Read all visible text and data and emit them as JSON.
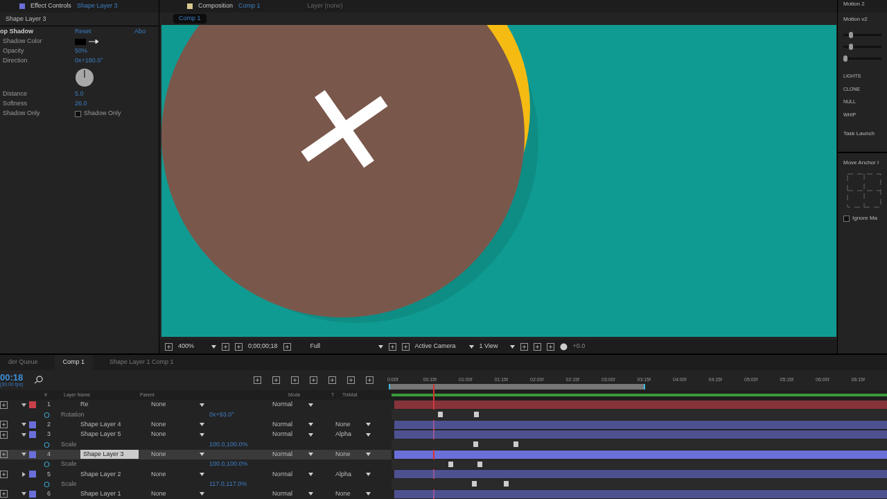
{
  "effect_panel": {
    "tab_label": "Effect Controls",
    "tab_layer": "Shape Layer 3",
    "layer_path": "Shape Layer 3",
    "effect_name": "op Shadow",
    "reset": "Reset",
    "about": "Abo",
    "properties": [
      {
        "kind": "color",
        "label": "Shadow Color"
      },
      {
        "kind": "value",
        "label": "Opacity",
        "value": "50%"
      },
      {
        "kind": "value",
        "label": "Direction",
        "value": "0x+180.0°"
      },
      {
        "kind": "dial"
      },
      {
        "kind": "value",
        "label": "Distance",
        "value": "5.0"
      },
      {
        "kind": "value",
        "label": "Softness",
        "value": "26.0"
      },
      {
        "kind": "checkbox",
        "label": "Shadow Only",
        "value": "Shadow Only",
        "checked": false
      }
    ]
  },
  "composition": {
    "tab_label": "Composition",
    "tab_comp": "Comp 1",
    "layer_tab": "Layer (none)",
    "subtab": "Comp 1",
    "toolbar": {
      "zoom": "400%",
      "time": "0;00;00;18",
      "resolution": "Full",
      "camera": "Active Camera",
      "views": "1 View",
      "exposure": "+0.0"
    }
  },
  "right_panel": {
    "tab": "Motion 2",
    "title": "Motion v2",
    "sliders": [
      {
        "level": 0.15
      },
      {
        "level": 0.15
      },
      {
        "level": 0.0
      }
    ],
    "buttons": [
      "LIGHTS",
      "CLONE",
      "NULL",
      "WHIP"
    ],
    "task": "Task Launch",
    "anchor_title": "Move Anchor I",
    "ignore": "Ignore Ma",
    "ignore_checked": false
  },
  "timeline": {
    "tabs": [
      {
        "label": "der Queue",
        "selected": false
      },
      {
        "label": "Comp 1",
        "selected": true
      },
      {
        "label": "Shape Layer 1 Comp 1",
        "selected": false
      }
    ],
    "current_time": "00:18",
    "fps": "(30.00 fps)",
    "columns": [
      "#",
      "Layer Name",
      "Parent",
      "Mode",
      "T",
      "TrkMat"
    ],
    "ruler": [
      "0:00f",
      "00:15f",
      "01:00f",
      "01:15f",
      "02:00f",
      "02:15f",
      "03:00f",
      "03:15f",
      "04:00f",
      "04:15f",
      "05:00f",
      "05:15f",
      "06:00f",
      "06:15f"
    ],
    "rows": [
      {
        "kind": "layer",
        "number": "1",
        "name": "Re",
        "color": "#c8404a",
        "parent": "None",
        "mode": "Normal",
        "trkmat": "",
        "selected": false
      },
      {
        "kind": "property",
        "name": "Rotation",
        "value": "0x+93.0°"
      },
      {
        "kind": "layer",
        "number": "2",
        "name": "Shape Layer 4",
        "color": "#6b6fd8",
        "parent": "None",
        "mode": "Normal",
        "trkmat": "None",
        "selected": false
      },
      {
        "kind": "layer",
        "number": "3",
        "name": "Shape Layer 5",
        "color": "#6b6fd8",
        "parent": "None",
        "mode": "Normal",
        "trkmat": "Alpha",
        "selected": false
      },
      {
        "kind": "property",
        "name": "Scale",
        "value": "100.0,100.0%"
      },
      {
        "kind": "layer",
        "number": "4",
        "name": "Shape Layer 3",
        "color": "#6b6fd8",
        "parent": "None",
        "mode": "Normal",
        "trkmat": "None",
        "selected": true
      },
      {
        "kind": "property",
        "name": "Scale",
        "value": "100.0,100.0%"
      },
      {
        "kind": "layer",
        "number": "5",
        "name": "Shape Layer 2",
        "color": "#6b6fd8",
        "parent": "None",
        "mode": "Normal",
        "trkmat": "Alpha",
        "selected": false
      },
      {
        "kind": "property",
        "name": "Scale",
        "value": "117.0,117.0%"
      },
      {
        "kind": "layer",
        "number": "6",
        "name": "Shape Layer 1",
        "color": "#6b6fd8",
        "parent": "None",
        "mode": "Normal",
        "trkmat": "None",
        "selected": false
      }
    ]
  }
}
